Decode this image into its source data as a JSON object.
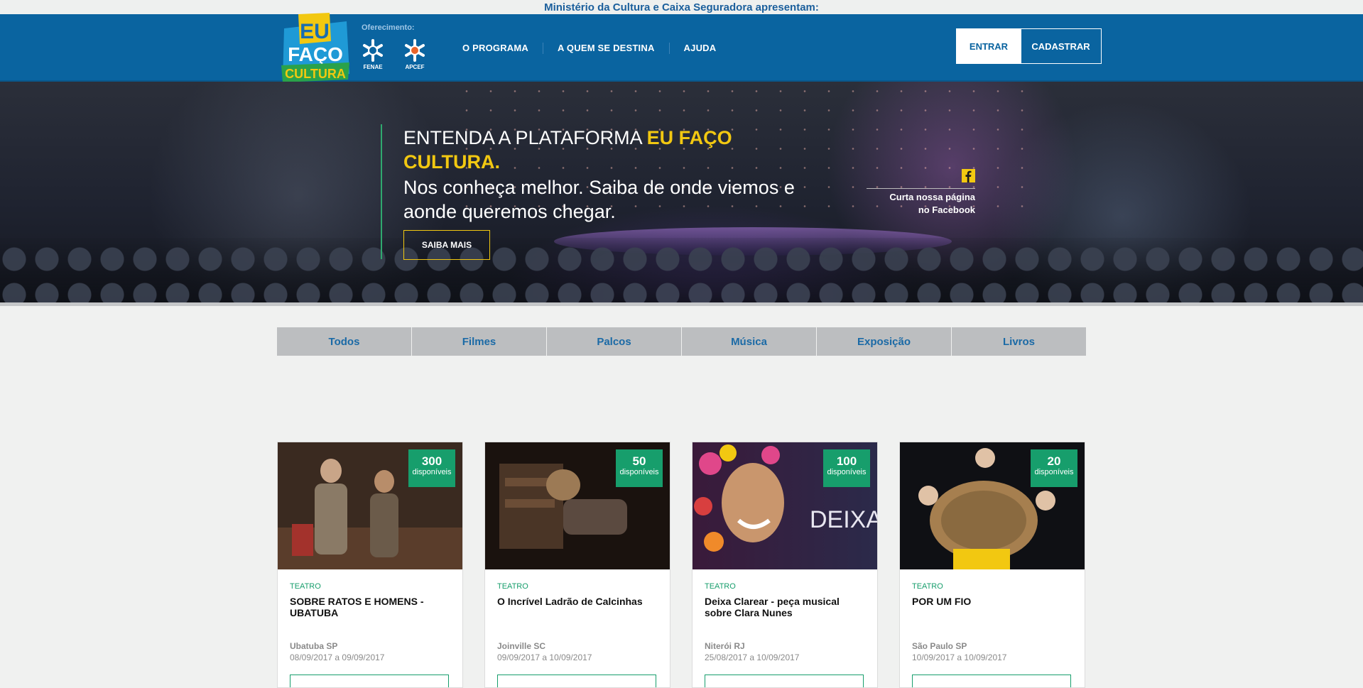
{
  "top_bar": {
    "text": "Ministério da Cultura e Caixa Seguradora apresentam:"
  },
  "header": {
    "logo_lines": [
      "EU",
      "FAÇO",
      "CULTURA"
    ],
    "oferecimento": "Oferecimento:",
    "sponsors": [
      "FENAE",
      "APCEF"
    ],
    "nav": [
      "O PROGRAMA",
      "A QUEM SE DESTINA",
      "AJUDA"
    ],
    "entrar": "ENTRAR",
    "cadastrar": "CADASTRAR"
  },
  "hero": {
    "title_plain": "ENTENDA A PLATAFORMA ",
    "title_highlight": "EU FAÇO CULTURA.",
    "subtitle": "Nos conheça melhor. Saiba de onde viemos e aonde queremos chegar.",
    "button": "SAIBA MAIS",
    "facebook_line1": "Curta nossa página",
    "facebook_line2": "no Facebook"
  },
  "tabs": [
    "Todos",
    "Filmes",
    "Palcos",
    "Música",
    "Exposição",
    "Livros"
  ],
  "cards": [
    {
      "count": "300",
      "count_label": "disponíveis",
      "category": "TEATRO",
      "title": "SOBRE RATOS E HOMENS - UBATUBA",
      "location": "Ubatuba SP",
      "dates": "08/09/2017 a 09/09/2017"
    },
    {
      "count": "50",
      "count_label": "disponíveis",
      "category": "TEATRO",
      "title": "O Incrível Ladrão de Calcinhas",
      "location": "Joinville SC",
      "dates": "09/09/2017 a 10/09/2017"
    },
    {
      "count": "100",
      "count_label": "disponíveis",
      "category": "TEATRO",
      "title": "Deixa Clarear - peça musical sobre Clara Nunes",
      "location": "Niterói RJ",
      "dates": "25/08/2017 a 10/09/2017",
      "image_text": "DEIXA CLAREA"
    },
    {
      "count": "20",
      "count_label": "disponíveis",
      "category": "TEATRO",
      "title": "POR UM FIO",
      "location": "São Paulo SP",
      "dates": "10/09/2017 a 10/09/2017"
    }
  ],
  "colors": {
    "brand_blue": "#0a64a0",
    "accent_yellow": "#f2c811",
    "accent_green": "#179e6c",
    "tab_gray": "#bcbec0"
  }
}
